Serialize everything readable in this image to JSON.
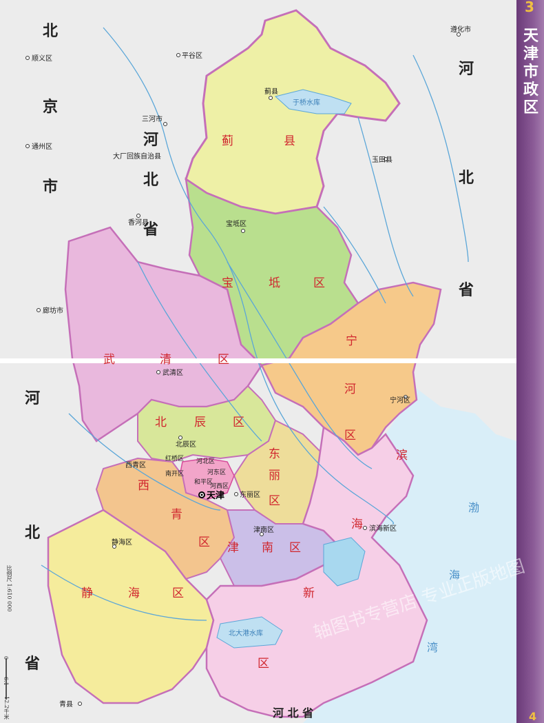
{
  "page": {
    "number_top": "3",
    "number_bottom": "4",
    "side_title": "天津市政区",
    "scale_text": "比例尺 1:610 000",
    "scale_ticks": [
      "0",
      "6.1",
      "12.2千米"
    ],
    "watermark": "轴图书专营店 专业正版地图"
  },
  "colors": {
    "jixian": "#eef0a6",
    "baodi": "#b9df8e",
    "ninghe": "#f6c98a",
    "wuqing": "#e9b8dd",
    "beichen": "#d8e79a",
    "dongli": "#eedd9a",
    "xiqing": "#f3c58e",
    "jinnan": "#cbbfe8",
    "jinghai": "#f5ec9c",
    "binhai": "#f6cfe7",
    "hebei_land": "#ececec",
    "sea": "#d9eef8",
    "border": "#c56fb8",
    "river": "#5aa6d8"
  },
  "labels": {
    "bj1": "北",
    "bj2": "京",
    "bj3": "市",
    "hb_top1": "河",
    "hb_top2": "北",
    "hb_top3": "省",
    "hb_mid1": "河",
    "hb_mid2": "北",
    "hb_mid3": "省",
    "hb_left1": "河",
    "hb_left2": "北",
    "hb_left3": "省",
    "hb_bottom": "河 北 省",
    "ji1": "蓟",
    "ji2": "县",
    "bao1": "宝",
    "bao2": "坻",
    "bao3": "区",
    "ning1": "宁",
    "ning2": "河",
    "ning3": "区",
    "wu1": "武",
    "wu2": "清",
    "wu3": "区",
    "bei1": "北",
    "bei2": "辰",
    "bei3": "区",
    "dong1": "东",
    "dong2": "丽",
    "dong3": "区",
    "xi1": "西",
    "xi2": "青",
    "xi3": "区",
    "jin1": "津",
    "jin2": "南",
    "jin3": "区",
    "jing1": "静",
    "jing2": "海",
    "jing3": "区",
    "bin1": "滨",
    "bin2": "海",
    "bin3": "新",
    "bin4": "区",
    "bohai1": "渤",
    "bohai2": "海",
    "bohai3": "湾",
    "yuqiao": "于桥水库",
    "beidagang": "北大港水库",
    "tianjin": "天津",
    "shunyi": "顺义区",
    "pinggu": "平谷区",
    "sanhe": "三河市",
    "tongzhou": "通州区",
    "dachang": "大厂回族自治县",
    "xianghe": "香河县",
    "langfang": "廊坊市",
    "zunhua": "遵化市",
    "yutian": "玉田县",
    "qingxian": "青县",
    "jixian_seat": "蓟县",
    "baodi_seat": "宝坻区",
    "ninghe_seat": "宁河区",
    "wuqing_seat": "武清区",
    "beichen_seat": "北辰区",
    "dongli_seat": "东丽区",
    "xiqing_seat": "西青区",
    "jinnan_seat": "津南区",
    "jinghai_seat": "静海区",
    "binhai_seat": "滨海新区",
    "hongqiao": "红桥区",
    "hebei_d": "河北区",
    "hedong": "河东区",
    "nankai": "南开区",
    "heping": "和平区",
    "hexi": "河西区"
  }
}
